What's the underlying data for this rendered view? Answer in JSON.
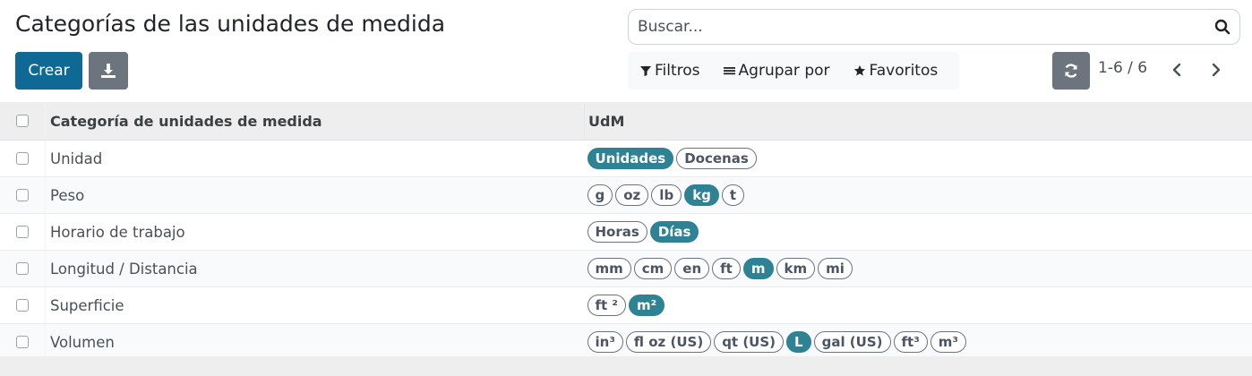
{
  "header": {
    "title": "Categorías de las unidades de medida",
    "create_label": "Crear",
    "download_icon": "download-icon"
  },
  "search": {
    "placeholder": "Buscar...",
    "icon": "search-icon"
  },
  "filters": {
    "filters_label": "Filtros",
    "group_by_label": "Agrupar por",
    "favorites_label": "Favoritos"
  },
  "pager": {
    "value": "1-6 / 6",
    "refresh_icon": "refresh-icon"
  },
  "table": {
    "columns": [
      "Categoría de unidades de medida",
      "UdM"
    ],
    "rows": [
      {
        "name": "Unidad",
        "uoms": [
          {
            "label": "Unidades",
            "reference": true
          },
          {
            "label": "Docenas",
            "reference": false
          }
        ]
      },
      {
        "name": "Peso",
        "uoms": [
          {
            "label": "g",
            "reference": false
          },
          {
            "label": "oz",
            "reference": false
          },
          {
            "label": "lb",
            "reference": false
          },
          {
            "label": "kg",
            "reference": true
          },
          {
            "label": "t",
            "reference": false
          }
        ]
      },
      {
        "name": "Horario de trabajo",
        "uoms": [
          {
            "label": "Horas",
            "reference": false
          },
          {
            "label": "Días",
            "reference": true
          }
        ]
      },
      {
        "name": "Longitud / Distancia",
        "uoms": [
          {
            "label": "mm",
            "reference": false
          },
          {
            "label": "cm",
            "reference": false
          },
          {
            "label": "en",
            "reference": false
          },
          {
            "label": "ft",
            "reference": false
          },
          {
            "label": "m",
            "reference": true
          },
          {
            "label": "km",
            "reference": false
          },
          {
            "label": "mi",
            "reference": false
          }
        ]
      },
      {
        "name": "Superficie",
        "uoms": [
          {
            "label": "ft ²",
            "reference": false
          },
          {
            "label": "m²",
            "reference": true
          }
        ]
      },
      {
        "name": "Volumen",
        "uoms": [
          {
            "label": "in³",
            "reference": false
          },
          {
            "label": "fl oz (US)",
            "reference": false
          },
          {
            "label": "qt (US)",
            "reference": false
          },
          {
            "label": "L",
            "reference": true
          },
          {
            "label": "gal (US)",
            "reference": false
          },
          {
            "label": "ft³",
            "reference": false
          },
          {
            "label": "m³",
            "reference": false
          }
        ]
      }
    ]
  },
  "colors": {
    "primary": "#0e6a95",
    "secondary": "#6c757d",
    "reference_tag": "#2f8294"
  }
}
